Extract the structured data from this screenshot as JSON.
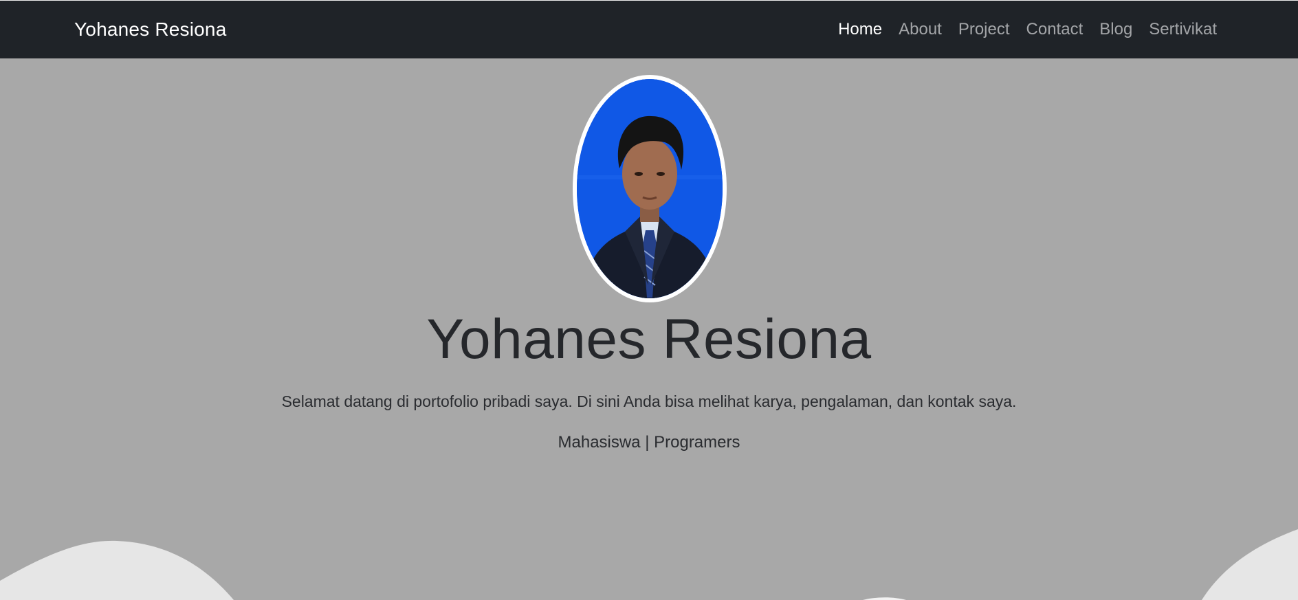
{
  "navbar": {
    "brand": "Yohanes Resiona",
    "links": [
      {
        "label": "Home",
        "active": true
      },
      {
        "label": "About",
        "active": false
      },
      {
        "label": "Project",
        "active": false
      },
      {
        "label": "Contact",
        "active": false
      },
      {
        "label": "Blog",
        "active": false
      },
      {
        "label": "Sertivikat",
        "active": false
      }
    ]
  },
  "hero": {
    "title": "Yohanes Resiona",
    "description": "Selamat datang di portofolio pribadi saya. Di sini Anda bisa melihat karya, pengalaman, dan kontak saya.",
    "role": "Mahasiswa | Programers",
    "avatar_icon": "profile-photo"
  },
  "colors": {
    "navbar_bg": "#1f2328",
    "page_bg": "#a8a8a8",
    "photo_bg": "#1058e6",
    "wave": "#e6e6e6"
  }
}
